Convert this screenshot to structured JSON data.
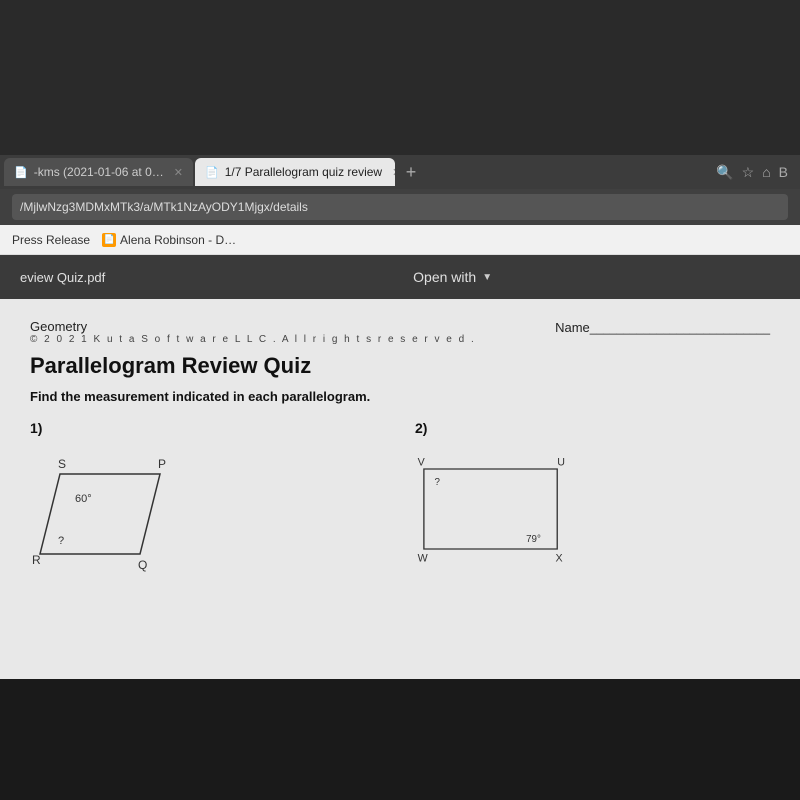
{
  "topArea": {
    "background": "#2a2a2a"
  },
  "browser": {
    "tabs": [
      {
        "id": "tab1",
        "label": "-kms (2021-01-06 at 0…",
        "active": false,
        "favicon": "📄"
      },
      {
        "id": "tab2",
        "label": "1/7 Parallelogram quiz review",
        "active": true,
        "favicon": "📄"
      }
    ],
    "newTabLabel": "+",
    "addressBar": {
      "url": "/MjlwNzg3MDMxMTk3/a/MTk1NzAyODY1Mjgx/details",
      "icons": [
        "🔍",
        "★",
        "🏠",
        "B"
      ]
    },
    "bookmarks": [
      {
        "label": "Press Release",
        "favicon": ""
      },
      {
        "label": "Alena Robinson - D…",
        "favicon": "🟧"
      }
    ]
  },
  "pdfToolbar": {
    "filename": "eview Quiz.pdf",
    "openWithLabel": "Open with",
    "dropdownArrow": "▼"
  },
  "pdf": {
    "subject": "Geometry",
    "nameLabel": "Name",
    "nameLine": "___________________________",
    "copyright": "© 2 0 2 1   K u t a   S o f t w a r e   L L C .   A l l   r i g h t s   r e s e r v e d .",
    "title": "Parallelogram Review  Quiz",
    "instructions": "Find the measurement indicated in each parallelogram.",
    "problems": [
      {
        "number": "1)",
        "shape": "parallelogram1",
        "labels": {
          "topLeft": "S",
          "topRight": "P",
          "bottomLeft": "R",
          "bottomRight": "Q",
          "angle1": "60°",
          "angle2": "?"
        }
      },
      {
        "number": "2)",
        "shape": "parallelogram2",
        "labels": {
          "topLeft": "V",
          "topRight": "U",
          "bottomLeft": "W",
          "bottomRight": "X",
          "angle1": "?",
          "angle2": "79°"
        }
      }
    ]
  }
}
